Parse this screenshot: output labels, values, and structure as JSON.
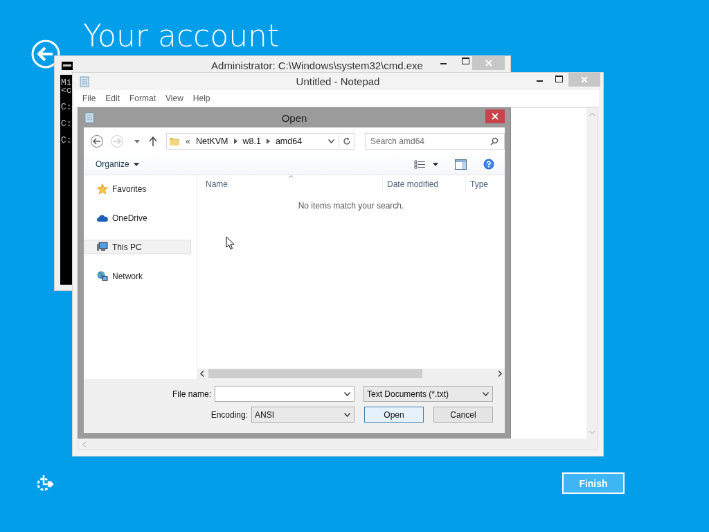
{
  "page": {
    "title": "Your account",
    "finish_button": "Finish"
  },
  "cmd_window": {
    "title": "Administrator: C:\\Windows\\system32\\cmd.exe",
    "console_lines": [
      "Mi",
      "<c",
      "C:",
      "C:",
      "C:"
    ]
  },
  "notepad_window": {
    "title": "Untitled - Notepad",
    "menu": [
      "File",
      "Edit",
      "Format",
      "View",
      "Help"
    ]
  },
  "open_dialog": {
    "title": "Open",
    "path_prefix": "«",
    "path": [
      "NetKVM",
      "w8.1",
      "amd64"
    ],
    "search": {
      "placeholder": "Search amd64"
    },
    "organize": "Organize",
    "nav_items": [
      {
        "label": "Favorites",
        "kind": "favorites",
        "selected": false
      },
      {
        "label": "OneDrive",
        "kind": "cloud",
        "selected": false
      },
      {
        "label": "This PC",
        "kind": "computer",
        "selected": true
      },
      {
        "label": "Network",
        "kind": "network",
        "selected": false
      }
    ],
    "columns": [
      "Name",
      "Date modified",
      "Type"
    ],
    "empty_message": "No items match your search.",
    "file_name_label": "File name:",
    "file_type": "Text Documents (*.txt)",
    "encoding": {
      "label": "Encoding:",
      "value": "ANSI"
    },
    "buttons": [
      {
        "label": "Open",
        "kind": "default"
      },
      {
        "label": "Cancel",
        "kind": "normal"
      }
    ]
  }
}
